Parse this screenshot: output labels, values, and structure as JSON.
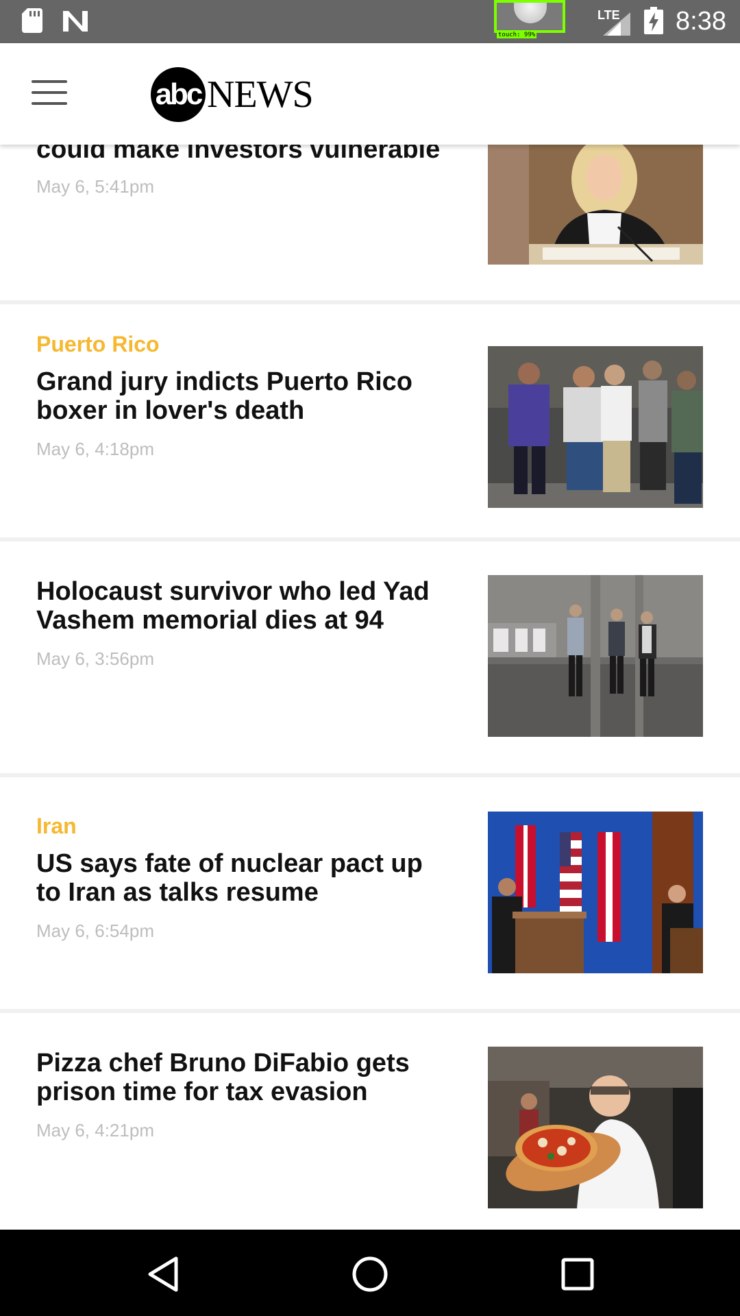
{
  "status_bar": {
    "time": "8:38",
    "network": "LTE",
    "touch_label": "touch: 99%",
    "icons": [
      "sd-card-icon",
      "n-icon",
      "signal-icon",
      "battery-charging-icon"
    ]
  },
  "app_bar": {
    "logo_circle_text": "abc",
    "logo_word": "NEWS"
  },
  "stories": [
    {
      "category": "",
      "headline": "could make investors vulnerable",
      "date": "May 6, 5:41pm",
      "image": "woman-at-hearing-photo"
    },
    {
      "category": "Puerto Rico",
      "headline": "Grand jury indicts Puerto Rico boxer in lover's death",
      "date": "May 6, 4:18pm",
      "image": "group-outside-photo"
    },
    {
      "category": "",
      "headline": "Holocaust survivor who led Yad Vashem memorial dies at 94",
      "date": "May 6, 3:56pm",
      "image": "men-in-hall-photo"
    },
    {
      "category": "Iran",
      "headline": "US says fate of nuclear pact up to Iran as talks resume",
      "date": "May 6, 6:54pm",
      "image": "podium-flags-photo"
    },
    {
      "category": "",
      "headline": "Pizza chef Bruno DiFabio gets prison time for tax evasion",
      "date": "May 6, 4:21pm",
      "image": "chef-with-pizza-photo"
    }
  ],
  "colors": {
    "status_bar": "#666666",
    "category": "#f5b830",
    "date": "#bdbdbd",
    "nav_bar": "#000000"
  },
  "nav_bar": {
    "icons": [
      "back-icon",
      "home-icon",
      "recents-icon"
    ]
  }
}
